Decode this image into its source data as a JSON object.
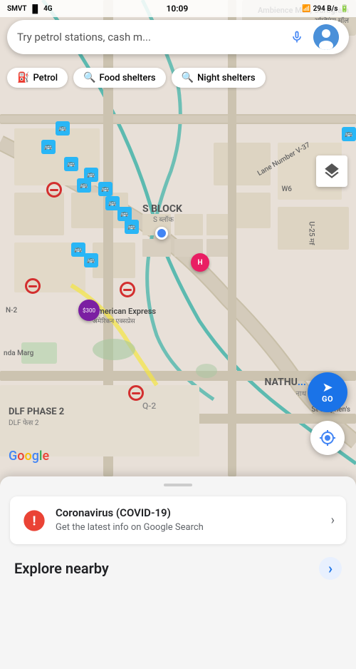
{
  "statusBar": {
    "carrier": "SMVT",
    "signal": "4G",
    "battery": "294",
    "time": "10:09"
  },
  "searchBar": {
    "placeholder": "Try petrol stations, cash m...",
    "micLabel": "voice-search"
  },
  "filterChips": [
    {
      "id": "petrol",
      "icon": "⛽",
      "label": "Petrol"
    },
    {
      "id": "food-shelters",
      "icon": "🔍",
      "label": "Food shelters"
    },
    {
      "id": "night-shelters",
      "icon": "🔍",
      "label": "Night shelters"
    }
  ],
  "mapLabels": {
    "sBlock": "S BLOCK",
    "sBlockHindi": "S ब्लॉक",
    "americanExpress": "American Express",
    "americanExpressHindi": "अमेरिकन एक्सप्रेस",
    "dlfPhase2": "DLF PHASE 2",
    "dlfPhase2Hindi": "DLF फेस 2",
    "nathupir": "NATHUPIR",
    "nathupirHindi": "नाथ",
    "laneNumber": "Lane Number V-37",
    "w6": "W6",
    "u25mf": "U-25 मf",
    "n2": "N-2",
    "ndaMarg": "nda Marg",
    "q2": "Q-2",
    "stStephens": "St Stephen's",
    "ambienceMall": "Ambience Mall, Gurugram",
    "ambienceMallHindi": "अम्बिएंस मॉल"
  },
  "buttons": {
    "go": "GO",
    "layers": "layers",
    "location": "my-location"
  },
  "googleLogo": "Google",
  "covidCard": {
    "title": "Coronavirus (COVID-19)",
    "subtitle": "Get the latest info on Google Search",
    "iconColor": "#ea4335"
  },
  "exploreSection": {
    "title": "Explore nearby",
    "chevron": "›"
  }
}
